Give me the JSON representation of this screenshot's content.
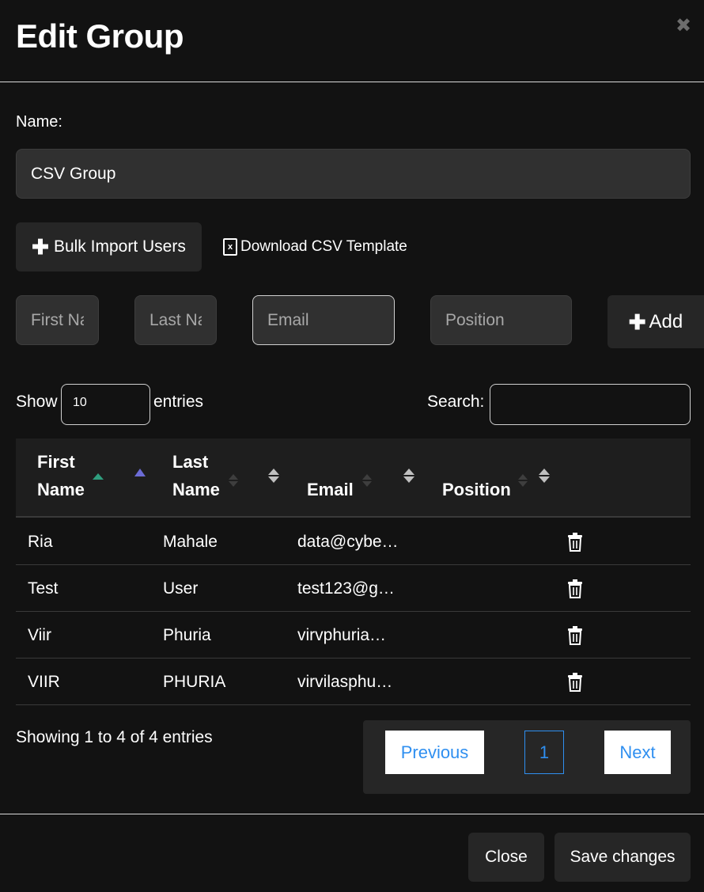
{
  "modal": {
    "title": "Edit Group",
    "close_icon": "close-icon"
  },
  "form": {
    "name_label": "Name:",
    "name_value": "CSV Group",
    "bulk_import_label": "Bulk Import Users",
    "download_template_label": "Download CSV Template"
  },
  "add_user": {
    "first_name_placeholder": "First Name",
    "last_name_placeholder": "Last Name",
    "email_placeholder": "Email",
    "position_placeholder": "Position",
    "add_label": "Add"
  },
  "table_controls": {
    "show_label": "Show",
    "entries_value": "10",
    "entries_label": "entries",
    "search_label": "Search:"
  },
  "table": {
    "columns": [
      "First Name",
      "Last Name",
      "Email",
      "Position"
    ],
    "rows": [
      {
        "first": "Ria",
        "last": "Mahale",
        "email": "data@cybe…",
        "position": ""
      },
      {
        "first": "Test",
        "last": "User",
        "email": "test123@g…",
        "position": ""
      },
      {
        "first": "Viir",
        "last": "Phuria",
        "email": "virvphuria…",
        "position": ""
      },
      {
        "first": "VIIR",
        "last": "PHURIA",
        "email": "virvilasphu…",
        "position": ""
      }
    ],
    "sort_active_color": "#2f9e7e",
    "sort_asc_color": "#6c6cd6"
  },
  "footer": {
    "info": "Showing 1 to 4 of 4 entries",
    "previous_label": "Previous",
    "page_number": "1",
    "next_label": "Next",
    "close_label": "Close",
    "save_label": "Save changes"
  }
}
